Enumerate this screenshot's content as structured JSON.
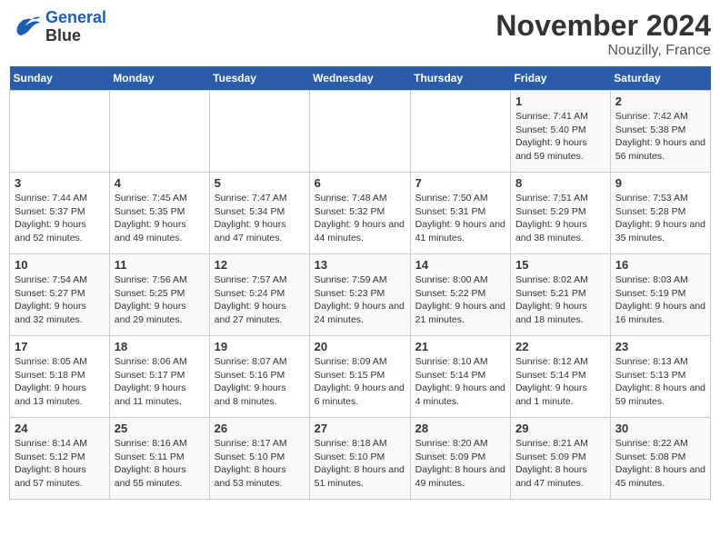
{
  "logo": {
    "line1": "General",
    "line2": "Blue"
  },
  "title": "November 2024",
  "location": "Nouzilly, France",
  "days_header": [
    "Sunday",
    "Monday",
    "Tuesday",
    "Wednesday",
    "Thursday",
    "Friday",
    "Saturday"
  ],
  "weeks": [
    [
      {
        "day": "",
        "info": ""
      },
      {
        "day": "",
        "info": ""
      },
      {
        "day": "",
        "info": ""
      },
      {
        "day": "",
        "info": ""
      },
      {
        "day": "",
        "info": ""
      },
      {
        "day": "1",
        "info": "Sunrise: 7:41 AM\nSunset: 5:40 PM\nDaylight: 9 hours and 59 minutes."
      },
      {
        "day": "2",
        "info": "Sunrise: 7:42 AM\nSunset: 5:38 PM\nDaylight: 9 hours and 56 minutes."
      }
    ],
    [
      {
        "day": "3",
        "info": "Sunrise: 7:44 AM\nSunset: 5:37 PM\nDaylight: 9 hours and 52 minutes."
      },
      {
        "day": "4",
        "info": "Sunrise: 7:45 AM\nSunset: 5:35 PM\nDaylight: 9 hours and 49 minutes."
      },
      {
        "day": "5",
        "info": "Sunrise: 7:47 AM\nSunset: 5:34 PM\nDaylight: 9 hours and 47 minutes."
      },
      {
        "day": "6",
        "info": "Sunrise: 7:48 AM\nSunset: 5:32 PM\nDaylight: 9 hours and 44 minutes."
      },
      {
        "day": "7",
        "info": "Sunrise: 7:50 AM\nSunset: 5:31 PM\nDaylight: 9 hours and 41 minutes."
      },
      {
        "day": "8",
        "info": "Sunrise: 7:51 AM\nSunset: 5:29 PM\nDaylight: 9 hours and 38 minutes."
      },
      {
        "day": "9",
        "info": "Sunrise: 7:53 AM\nSunset: 5:28 PM\nDaylight: 9 hours and 35 minutes."
      }
    ],
    [
      {
        "day": "10",
        "info": "Sunrise: 7:54 AM\nSunset: 5:27 PM\nDaylight: 9 hours and 32 minutes."
      },
      {
        "day": "11",
        "info": "Sunrise: 7:56 AM\nSunset: 5:25 PM\nDaylight: 9 hours and 29 minutes."
      },
      {
        "day": "12",
        "info": "Sunrise: 7:57 AM\nSunset: 5:24 PM\nDaylight: 9 hours and 27 minutes."
      },
      {
        "day": "13",
        "info": "Sunrise: 7:59 AM\nSunset: 5:23 PM\nDaylight: 9 hours and 24 minutes."
      },
      {
        "day": "14",
        "info": "Sunrise: 8:00 AM\nSunset: 5:22 PM\nDaylight: 9 hours and 21 minutes."
      },
      {
        "day": "15",
        "info": "Sunrise: 8:02 AM\nSunset: 5:21 PM\nDaylight: 9 hours and 18 minutes."
      },
      {
        "day": "16",
        "info": "Sunrise: 8:03 AM\nSunset: 5:19 PM\nDaylight: 9 hours and 16 minutes."
      }
    ],
    [
      {
        "day": "17",
        "info": "Sunrise: 8:05 AM\nSunset: 5:18 PM\nDaylight: 9 hours and 13 minutes."
      },
      {
        "day": "18",
        "info": "Sunrise: 8:06 AM\nSunset: 5:17 PM\nDaylight: 9 hours and 11 minutes."
      },
      {
        "day": "19",
        "info": "Sunrise: 8:07 AM\nSunset: 5:16 PM\nDaylight: 9 hours and 8 minutes."
      },
      {
        "day": "20",
        "info": "Sunrise: 8:09 AM\nSunset: 5:15 PM\nDaylight: 9 hours and 6 minutes."
      },
      {
        "day": "21",
        "info": "Sunrise: 8:10 AM\nSunset: 5:14 PM\nDaylight: 9 hours and 4 minutes."
      },
      {
        "day": "22",
        "info": "Sunrise: 8:12 AM\nSunset: 5:14 PM\nDaylight: 9 hours and 1 minute."
      },
      {
        "day": "23",
        "info": "Sunrise: 8:13 AM\nSunset: 5:13 PM\nDaylight: 8 hours and 59 minutes."
      }
    ],
    [
      {
        "day": "24",
        "info": "Sunrise: 8:14 AM\nSunset: 5:12 PM\nDaylight: 8 hours and 57 minutes."
      },
      {
        "day": "25",
        "info": "Sunrise: 8:16 AM\nSunset: 5:11 PM\nDaylight: 8 hours and 55 minutes."
      },
      {
        "day": "26",
        "info": "Sunrise: 8:17 AM\nSunset: 5:10 PM\nDaylight: 8 hours and 53 minutes."
      },
      {
        "day": "27",
        "info": "Sunrise: 8:18 AM\nSunset: 5:10 PM\nDaylight: 8 hours and 51 minutes."
      },
      {
        "day": "28",
        "info": "Sunrise: 8:20 AM\nSunset: 5:09 PM\nDaylight: 8 hours and 49 minutes."
      },
      {
        "day": "29",
        "info": "Sunrise: 8:21 AM\nSunset: 5:09 PM\nDaylight: 8 hours and 47 minutes."
      },
      {
        "day": "30",
        "info": "Sunrise: 8:22 AM\nSunset: 5:08 PM\nDaylight: 8 hours and 45 minutes."
      }
    ]
  ]
}
